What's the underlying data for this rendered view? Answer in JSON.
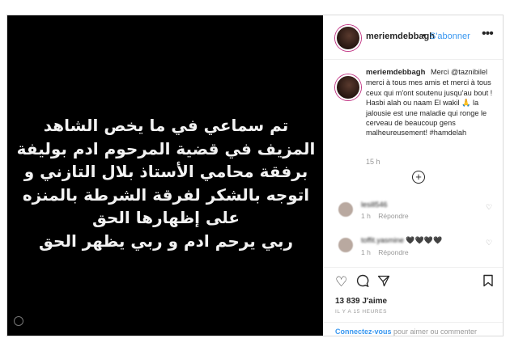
{
  "post": {
    "arabic_lines": [
      "تم سماعي في ما يخص الشاهد",
      "المزيف في قضية المرحوم ادم بوليفة",
      "برفقة محامي الأستاذ بلال التازني و",
      "اتوجه بالشكر لفرقة الشرطة بالمنزه",
      "على إظهارها الحق",
      "ربي يرحم ادم و ربي يظهر الحق"
    ]
  },
  "header": {
    "username": "meriemdebbagh",
    "separator": "•",
    "follow_label": "S'abonner",
    "more_icon": "more-dots-icon"
  },
  "caption": {
    "username": "meriemdebbagh",
    "text": "Merci @taznibilel merci à tous mes amis et merci à tous ceux qui m'ont soutenu jusqu'au bout ! Hasbi alah ou naam El wakil 🙏 la jalousie est une maladie qui ronge le cerveau de beaucoup gens malheureusement! #hamdelah",
    "time": "15 h",
    "load_more_icon": "plus-circle-icon"
  },
  "comments": [
    {
      "username": "lesill546",
      "text": "",
      "reply_label": "Répondre",
      "time": "1 h"
    },
    {
      "username": "toffit.yasmine",
      "text": "🖤🖤🖤🖤",
      "reply_label": "Répondre",
      "time": "1 h"
    }
  ],
  "actions": {
    "icons": [
      "heart-icon",
      "comment-icon",
      "share-icon",
      "bookmark-icon"
    ],
    "likes": "13 839 J'aime",
    "posted_ago": "IL Y A 15 HEURES"
  },
  "login": {
    "link_label": "Connectez-vous",
    "rest": " pour aimer ou commenter"
  }
}
